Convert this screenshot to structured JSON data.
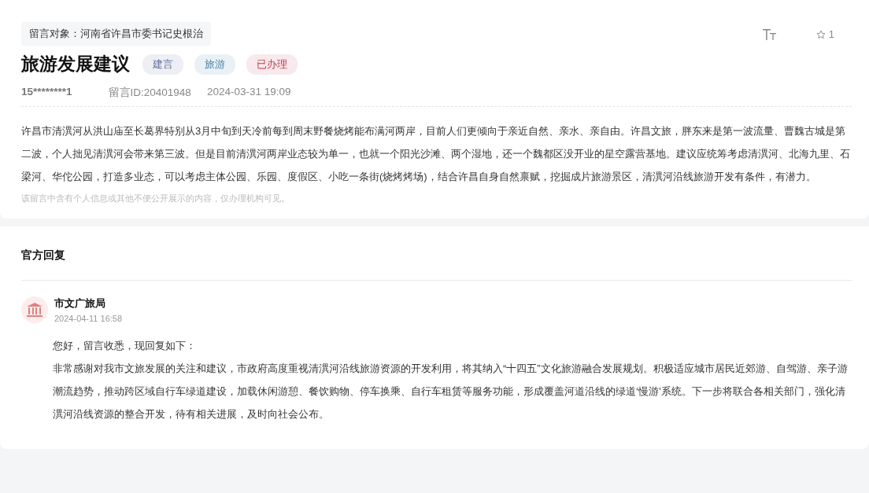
{
  "message": {
    "target": "留言对象：河南省许昌市委书记史根治",
    "title": "旅游发展建议",
    "tags": [
      {
        "label": "建言",
        "color": "#5b6b99"
      },
      {
        "label": "旅游",
        "color": "#3f7fa8"
      },
      {
        "label": "已办理",
        "color": "#c23b4e"
      }
    ],
    "star_count": "1",
    "author": "15********1",
    "message_id": "留言ID:20401948",
    "time": "2024-03-31 19:09",
    "body": "许昌市清潩河从洪山庙至长葛界特别从3月中旬到天冷前每到周末野餐烧烤能布满河两岸，目前人们更倾向于亲近自然、亲水、亲自由。许昌文旅，胖东来是第一波流量、曹魏古城是第二波，个人拙见清潩河会带来第三波。但是目前清潩河两岸业态较为单一，也就一个阳光沙滩、两个湿地，还一个魏都区没开业的星空露营基地。建议应统筹考虑清潩河、北海九里、石梁河、华佗公园，打造多业态，可以考虑主体公园、乐园、度假区、小吃一条街(烧烤烤场)，结合许昌自身自然禀赋，挖掘成片旅游景区，清潩河沿线旅游开发有条件，有潜力。",
    "notice": "该留言中含有个人信息或其他不便公开展示的内容，仅办理机构可见。"
  },
  "reply": {
    "heading": "官方回复",
    "department": "市文广旅局",
    "time": "2024-04-11 16:58",
    "greeting": "您好，留言收悉，现回复如下：",
    "body": "非常感谢对我市文旅发展的关注和建议，市政府高度重视清潩河沿线旅游资源的开发利用，将其纳入“十四五”文化旅游融合发展规划。积极适应城市居民近郊游、自驾游、亲子游潮流趋势，推动跨区域自行车绿道建设，加载休闲游憩、餐饮购物、停车换乘、自行车租赁等服务功能，形成覆盖河道沿线的绿道‘慢游’系统。下一步将联合各相关部门，强化清潩河沿线资源的整合开发，待有相关进展，及时向社会公布。"
  }
}
